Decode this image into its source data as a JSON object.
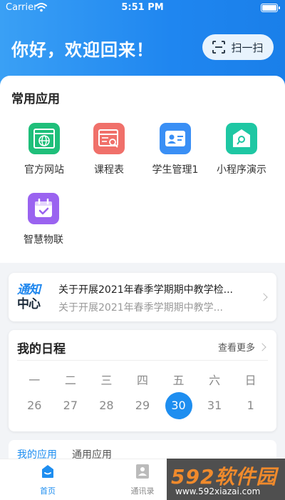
{
  "status_bar": {
    "carrier": "Carrier",
    "time": "5:51 PM"
  },
  "header": {
    "greeting": "你好，欢迎回来！",
    "scan_label": "扫一扫"
  },
  "common_apps": {
    "title": "常用应用",
    "items": [
      {
        "label": "官方网站",
        "icon": "globe-icon",
        "color": "#1fbf7a"
      },
      {
        "label": "课程表",
        "icon": "course-icon",
        "color": "#f0706a"
      },
      {
        "label": "学生管理1",
        "icon": "student-card-icon",
        "color": "#3a8ff5"
      },
      {
        "label": "小程序演示",
        "icon": "mini-program-icon",
        "color": "#1ec7a3"
      },
      {
        "label": "智慧物联",
        "icon": "calendar-check-icon",
        "color": "#9a63f0"
      }
    ]
  },
  "notice": {
    "logo_line1": "通知",
    "logo_line2": "中心",
    "title": "关于开展2021年春季学期期中教学检...",
    "subtitle": "关于开展2021年春季学期期中教学..."
  },
  "schedule": {
    "title": "我的日程",
    "more": "查看更多",
    "weekdays": [
      "一",
      "二",
      "三",
      "四",
      "五",
      "六",
      "日"
    ],
    "dates": [
      "26",
      "27",
      "28",
      "29",
      "30",
      "31",
      "1"
    ],
    "selected_index": 4
  },
  "my_apps": {
    "tab_active": "我的应用",
    "tab_other": "通用应用"
  },
  "tabbar": {
    "home": "首页",
    "contacts": "通讯录"
  },
  "watermark": {
    "main": "592软件园",
    "url": "www.592xiazai.com"
  },
  "colors": {
    "accent": "#1e8ef0",
    "header_gradient_start": "#3aa0f5",
    "header_gradient_end": "#1a7fe9"
  }
}
